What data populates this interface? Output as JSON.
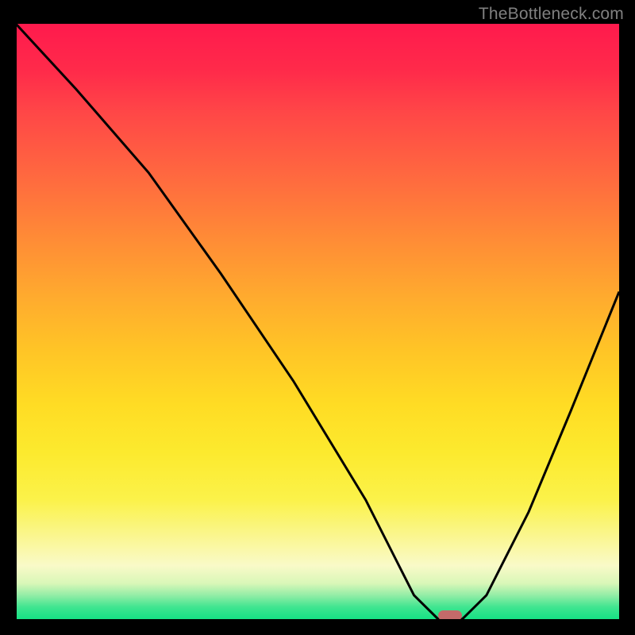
{
  "watermark": {
    "text": "TheBottleneck.com"
  },
  "chart_data": {
    "type": "line",
    "title": "",
    "xlabel": "",
    "ylabel": "",
    "xlim": [
      0,
      100
    ],
    "ylim": [
      0,
      100
    ],
    "grid": false,
    "legend": false,
    "series": [
      {
        "name": "bottleneck-curve",
        "x": [
          0,
          10,
          22,
          34,
          46,
          58,
          62,
          66,
          70,
          74,
          78,
          85,
          92,
          100
        ],
        "values": [
          100,
          89,
          75,
          58,
          40,
          20,
          12,
          4,
          0,
          0,
          4,
          18,
          35,
          55
        ]
      }
    ],
    "optimum_marker": {
      "x": 72,
      "y": 0
    }
  },
  "colors": {
    "gradient_top": "#ff1a4d",
    "gradient_bottom": "#16e184",
    "curve": "#000000",
    "marker": "#c46a6a",
    "background": "#000000",
    "watermark": "#808080"
  }
}
